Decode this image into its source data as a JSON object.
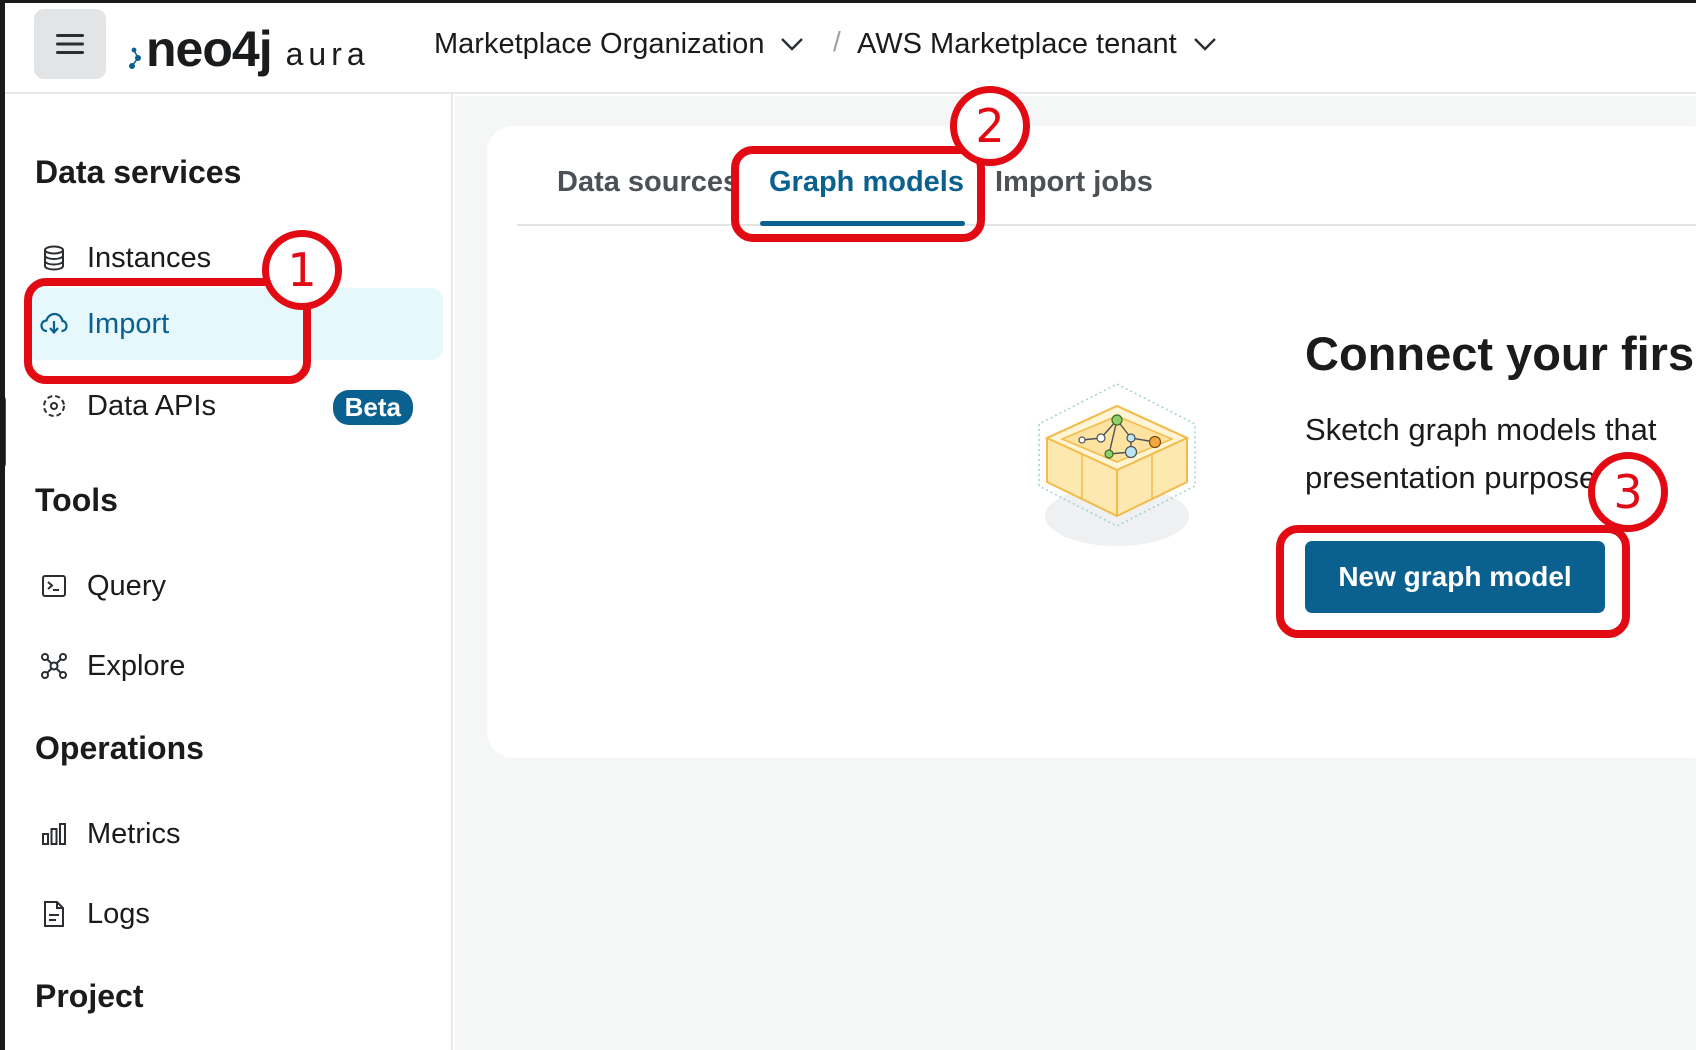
{
  "header": {
    "brand_main": "neo4j",
    "brand_sub": "aura",
    "org": "Marketplace Organization",
    "separator": "/",
    "tenant": "AWS Marketplace tenant"
  },
  "sidebar": {
    "sections": [
      {
        "title": "Data services"
      },
      {
        "title": "Tools"
      },
      {
        "title": "Operations"
      },
      {
        "title": "Project"
      }
    ],
    "items": [
      {
        "label": "Instances",
        "icon": "database-icon"
      },
      {
        "label": "Import",
        "icon": "cloud-download-icon",
        "active": true
      },
      {
        "label": "Data APIs",
        "icon": "api-icon",
        "badge": "Beta"
      },
      {
        "label": "Query",
        "icon": "terminal-icon"
      },
      {
        "label": "Explore",
        "icon": "graph-icon"
      },
      {
        "label": "Metrics",
        "icon": "bar-chart-icon"
      },
      {
        "label": "Logs",
        "icon": "document-icon"
      }
    ]
  },
  "tabs": [
    {
      "label": "Data sources"
    },
    {
      "label": "Graph models",
      "active": true
    },
    {
      "label": "Import jobs"
    }
  ],
  "empty_state": {
    "headline": "Connect your firs",
    "description": "Sketch graph models that presentation purposes.",
    "button": "New graph model"
  },
  "annotations": [
    "1",
    "2",
    "3"
  ],
  "colors": {
    "accent": "#0a6190",
    "active_bg": "#e6f8fb",
    "annotation": "#e20a13"
  }
}
